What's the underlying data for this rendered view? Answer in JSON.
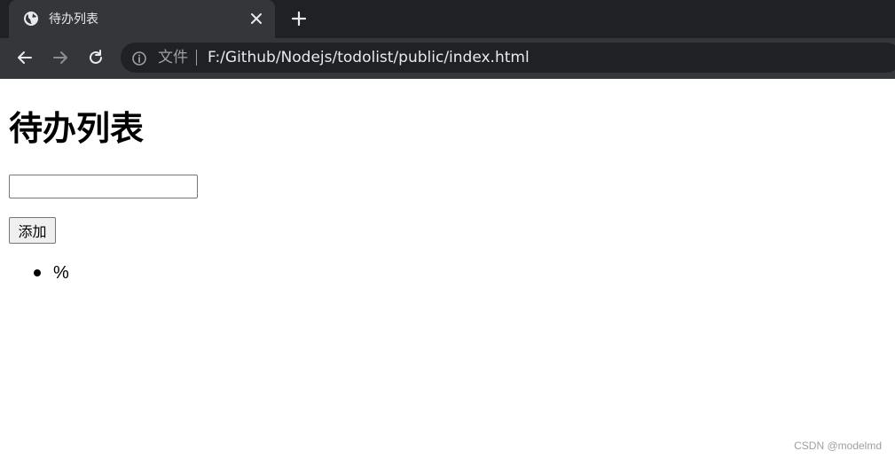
{
  "browser": {
    "tab": {
      "title": "待办列表",
      "favicon": "globe-icon"
    },
    "toolbar": {
      "back": "arrow-left-icon",
      "forward": "arrow-right-icon",
      "reload": "reload-icon"
    },
    "omnibox": {
      "security_icon": "info-icon",
      "chip_label": "文件",
      "url": "F:/Github/Nodejs/todolist/public/index.html"
    },
    "colors": {
      "tabstrip_bg": "#202124",
      "toolbar_bg": "#35363a",
      "text_light": "#e8eaed",
      "text_muted": "#9aa0a6"
    }
  },
  "page": {
    "heading": "待办列表",
    "input": {
      "value": "",
      "placeholder": ""
    },
    "add_button_label": "添加",
    "todos": [
      {
        "text": "%"
      }
    ]
  },
  "watermark": "CSDN @modelmd"
}
